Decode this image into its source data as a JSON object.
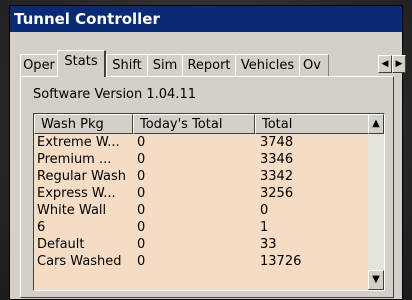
{
  "window": {
    "title": "Tunnel Controller"
  },
  "tabs": [
    {
      "label": "Oper"
    },
    {
      "label": "Stats",
      "active": true
    },
    {
      "label": "Shift"
    },
    {
      "label": "Sim"
    },
    {
      "label": "Report"
    },
    {
      "label": "Vehicles"
    },
    {
      "label": "Ov"
    }
  ],
  "tab_scroll": {
    "left_icon": "◀",
    "right_icon": "▶"
  },
  "stats": {
    "version": "Software Version 1.04.11",
    "columns": [
      "Wash Pkg",
      "Today's Total",
      "Total"
    ],
    "rows": [
      [
        "Extreme W...",
        "0",
        "3748"
      ],
      [
        "Premium ...",
        "0",
        "3346"
      ],
      [
        "Regular Wash",
        "0",
        "3342"
      ],
      [
        "Express W...",
        "0",
        "3256"
      ],
      [
        "White Wall",
        "0",
        "0"
      ],
      [
        "6",
        "0",
        "1"
      ],
      [
        "Default",
        "0",
        "33"
      ],
      [
        "Cars Washed",
        "0",
        "13726"
      ]
    ]
  },
  "scrollbar": {
    "up_icon": "▲",
    "down_icon": "▼"
  }
}
